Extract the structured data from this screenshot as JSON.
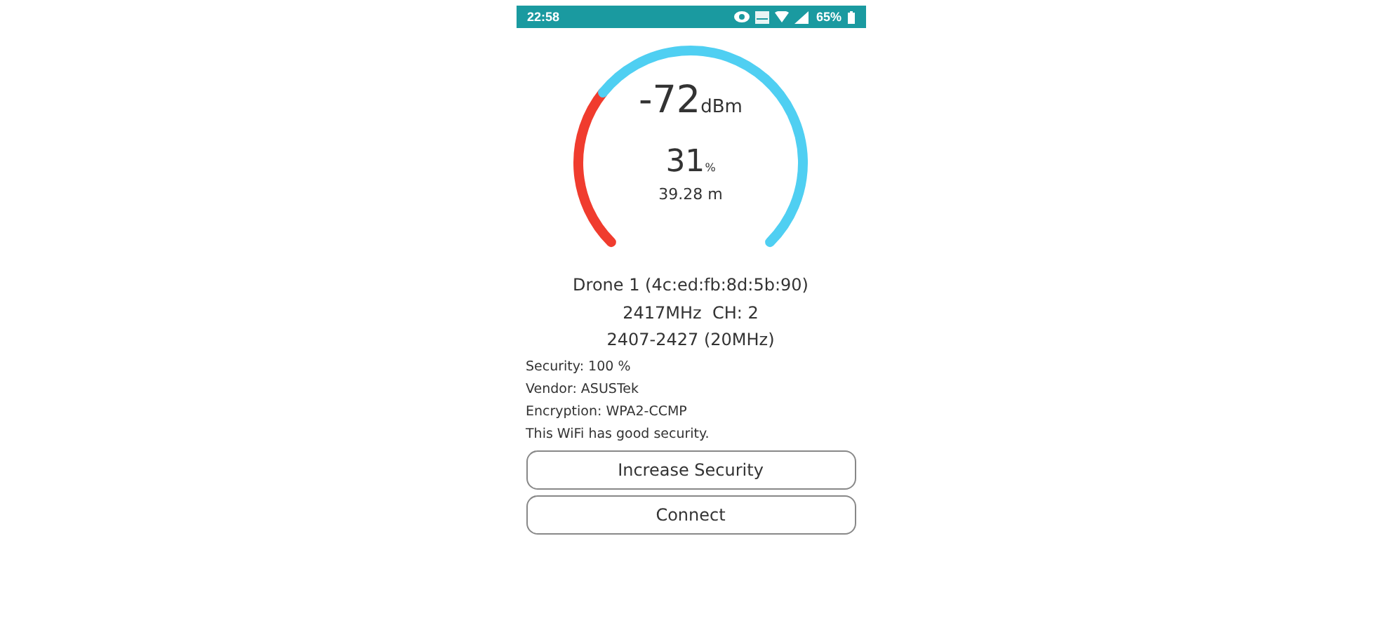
{
  "status_bar": {
    "time": "22:58",
    "battery": "65%"
  },
  "gauge": {
    "signal": "-72",
    "signal_unit": "dBm",
    "quality": "31",
    "quality_unit": "%",
    "distance": "39.28 m"
  },
  "network": {
    "name": "Drone 1 (4c:ed:fb:8d:5b:90)",
    "frequency": "2417MHz  CH: 2",
    "range": "2407-2427 (20MHz)"
  },
  "details": [
    "Security: 100 %",
    "Vendor: ASUSTek",
    "Encryption: WPA2-CCMP",
    "This WiFi has good security."
  ],
  "buttons": [
    "Increase Security",
    "Connect"
  ]
}
